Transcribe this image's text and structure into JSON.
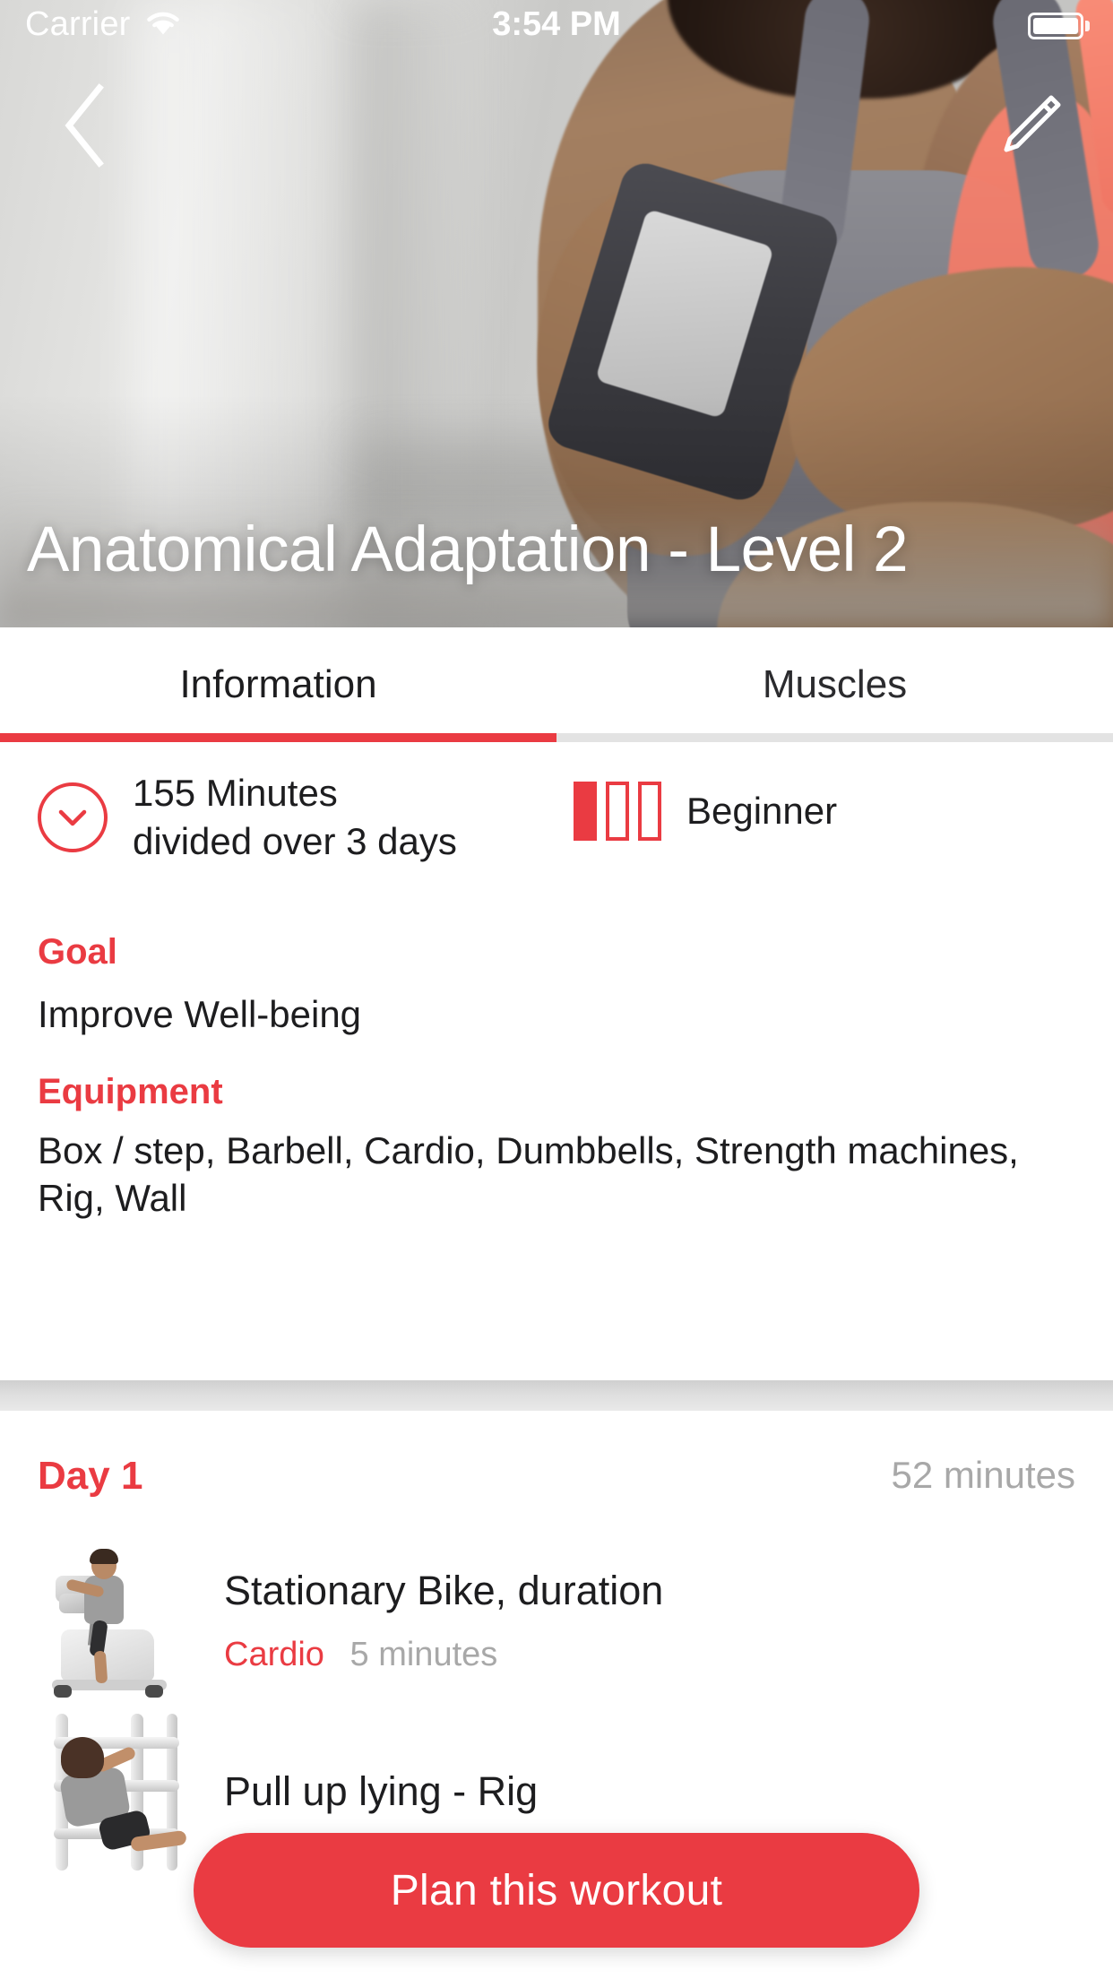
{
  "status_bar": {
    "carrier": "Carrier",
    "wifi_icon": "wifi-icon",
    "time": "3:54 PM",
    "battery_icon": "battery-full-icon"
  },
  "hero": {
    "back_icon": "chevron-left-icon",
    "edit_icon": "pencil-icon",
    "title": "Anatomical Adaptation - Level 2"
  },
  "tabs": {
    "active_index": 0,
    "items": [
      {
        "label": "Information"
      },
      {
        "label": "Muscles"
      }
    ]
  },
  "info": {
    "duration_icon": "chevron-down-circle-icon",
    "duration_line1": "155 Minutes",
    "duration_line2": "divided over 3 days",
    "level_icon": "difficulty-bars-icon",
    "level_filled_bars": 1,
    "level_total_bars": 3,
    "level_label": "Beginner",
    "goal_heading": "Goal",
    "goal_value": "Improve Well-being",
    "equipment_heading": "Equipment",
    "equipment_value": "Box / step, Barbell, Cardio, Dumbbells, Strength machines, Rig, Wall"
  },
  "day": {
    "heading": "Day 1",
    "duration": "52 minutes",
    "exercises": [
      {
        "thumb": "stationary-bike-thumbnail",
        "name": "Stationary Bike, duration",
        "category": "Cardio",
        "time": "5 minutes"
      },
      {
        "thumb": "pull-up-lying-rig-thumbnail",
        "name": "Pull up lying - Rig",
        "category": "",
        "time": ""
      }
    ]
  },
  "cta": {
    "label": "Plan this workout"
  },
  "colors": {
    "accent_red": "#ea3b42",
    "text_primary": "#1d1d1f",
    "text_muted": "#a8a8a8",
    "surface": "#ffffff"
  }
}
